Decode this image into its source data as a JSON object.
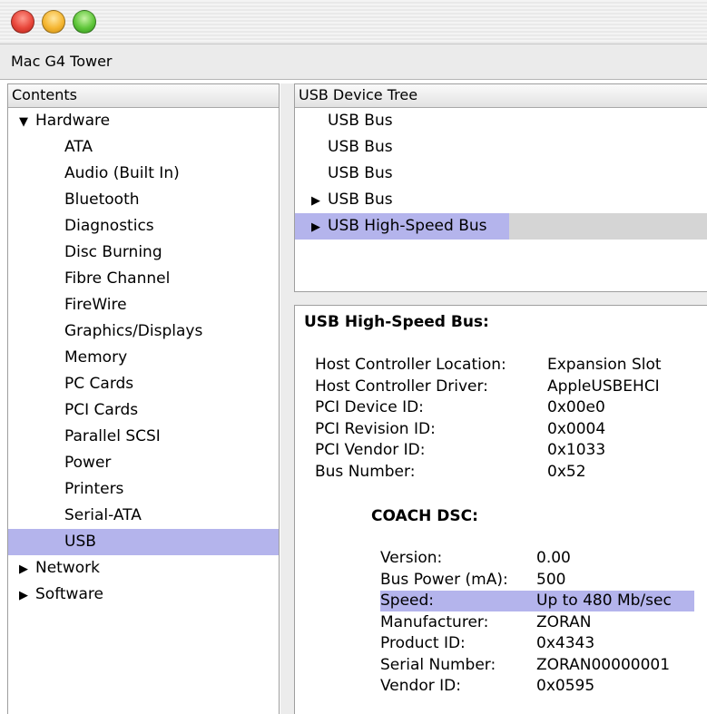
{
  "window": {
    "title": "Mac G4 Tower"
  },
  "sidebar": {
    "header": "Contents",
    "items": [
      {
        "label": "Hardware",
        "level": 0,
        "expanded": true
      },
      {
        "label": "ATA",
        "level": 1
      },
      {
        "label": "Audio (Built In)",
        "level": 1
      },
      {
        "label": "Bluetooth",
        "level": 1
      },
      {
        "label": "Diagnostics",
        "level": 1
      },
      {
        "label": "Disc Burning",
        "level": 1
      },
      {
        "label": "Fibre Channel",
        "level": 1
      },
      {
        "label": "FireWire",
        "level": 1
      },
      {
        "label": "Graphics/Displays",
        "level": 1
      },
      {
        "label": "Memory",
        "level": 1
      },
      {
        "label": "PC Cards",
        "level": 1
      },
      {
        "label": "PCI Cards",
        "level": 1
      },
      {
        "label": "Parallel SCSI",
        "level": 1
      },
      {
        "label": "Power",
        "level": 1
      },
      {
        "label": "Printers",
        "level": 1
      },
      {
        "label": "Serial-ATA",
        "level": 1
      },
      {
        "label": "USB",
        "level": 1,
        "selected": true
      },
      {
        "label": "Network",
        "level": 0,
        "expanded": false
      },
      {
        "label": "Software",
        "level": 0,
        "expanded": false
      }
    ]
  },
  "device_tree": {
    "header": "USB Device Tree",
    "items": [
      {
        "label": "USB Bus"
      },
      {
        "label": "USB Bus"
      },
      {
        "label": "USB Bus"
      },
      {
        "label": "USB Bus",
        "expandable": true
      },
      {
        "label": "USB High-Speed Bus",
        "expandable": true,
        "selected": true
      }
    ]
  },
  "detail": {
    "title": "USB High-Speed Bus:",
    "properties": [
      {
        "key": "Host Controller Location:",
        "value": "Expansion Slot"
      },
      {
        "key": "Host Controller Driver:",
        "value": "AppleUSBEHCI"
      },
      {
        "key": "PCI Device ID:",
        "value": "0x00e0"
      },
      {
        "key": "PCI Revision ID:",
        "value": "0x0004"
      },
      {
        "key": "PCI Vendor ID:",
        "value": "0x1033"
      },
      {
        "key": "Bus Number:",
        "value": "0x52"
      }
    ],
    "device": {
      "title": "COACH DSC:",
      "properties": [
        {
          "key": "Version:",
          "value": "0.00"
        },
        {
          "key": "Bus Power (mA):",
          "value": "500"
        },
        {
          "key": "Speed:",
          "value": "Up to 480 Mb/sec",
          "highlighted": true
        },
        {
          "key": "Manufacturer:",
          "value": "ZORAN"
        },
        {
          "key": "Product ID:",
          "value": "0x4343"
        },
        {
          "key": "Serial Number:",
          "value": "ZORAN00000001"
        },
        {
          "key": "Vendor ID:",
          "value": "0x0595"
        }
      ]
    }
  },
  "colors": {
    "selection": "#b4b4ec",
    "row_selected_gray": "#d5d5d5"
  },
  "icons": {
    "expanded": "disclosure-triangle-down",
    "collapsed": "disclosure-triangle-right"
  }
}
